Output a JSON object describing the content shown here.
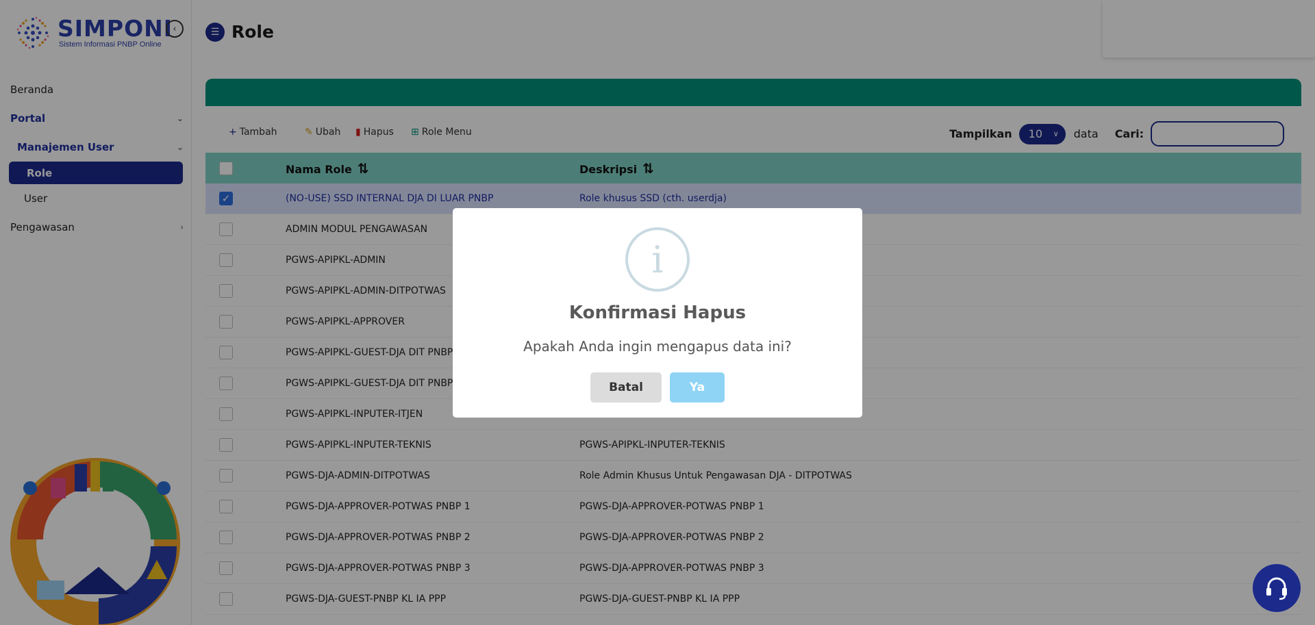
{
  "brand": {
    "title": "SIMPONI",
    "subtitle": "Sistem Informasi PNBP Online"
  },
  "sidebar": {
    "items": [
      {
        "label": "Beranda"
      },
      {
        "label": "Portal"
      },
      {
        "label": "Manajemen User"
      },
      {
        "label": "Role"
      },
      {
        "label": "User"
      },
      {
        "label": "Pengawasan"
      }
    ]
  },
  "page": {
    "title": "Role"
  },
  "toolbar": {
    "add_label": "Tambah",
    "edit_label": "Ubah",
    "delete_label": "Hapus",
    "role_menu_label": "Role Menu",
    "show_label": "Tampilkan",
    "page_length": "10",
    "data_label": "data",
    "search_label": "Cari:",
    "search_value": ""
  },
  "table": {
    "columns": [
      "Nama Role",
      "Deskripsi"
    ],
    "rows": [
      {
        "name": "(NO-USE) SSD INTERNAL DJA DI LUAR PNBP",
        "desc": "Role khusus SSD (cth. userdja)",
        "checked": true
      },
      {
        "name": "ADMIN MODUL PENGAWASAN",
        "desc": "",
        "checked": false
      },
      {
        "name": "PGWS-APIPKL-ADMIN",
        "desc": "",
        "checked": false
      },
      {
        "name": "PGWS-APIPKL-ADMIN-DITPOTWAS",
        "desc": "",
        "checked": false
      },
      {
        "name": "PGWS-APIPKL-APPROVER",
        "desc": "",
        "checked": false
      },
      {
        "name": "PGWS-APIPKL-GUEST-DJA DIT PNBP KL",
        "desc": "",
        "checked": false
      },
      {
        "name": "PGWS-APIPKL-GUEST-DJA DIT PNBP SDA",
        "desc": "",
        "checked": false
      },
      {
        "name": "PGWS-APIPKL-INPUTER-ITJEN",
        "desc": "",
        "checked": false
      },
      {
        "name": "PGWS-APIPKL-INPUTER-TEKNIS",
        "desc": "PGWS-APIPKL-INPUTER-TEKNIS",
        "checked": false
      },
      {
        "name": "PGWS-DJA-ADMIN-DITPOTWAS",
        "desc": "Role Admin Khusus Untuk Pengawasan DJA - DITPOTWAS",
        "checked": false
      },
      {
        "name": "PGWS-DJA-APPROVER-POTWAS PNBP 1",
        "desc": "PGWS-DJA-APPROVER-POTWAS PNBP 1",
        "checked": false
      },
      {
        "name": "PGWS-DJA-APPROVER-POTWAS PNBP 2",
        "desc": "PGWS-DJA-APPROVER-POTWAS PNBP 2",
        "checked": false
      },
      {
        "name": "PGWS-DJA-APPROVER-POTWAS PNBP 3",
        "desc": "PGWS-DJA-APPROVER-POTWAS PNBP 3",
        "checked": false
      },
      {
        "name": "PGWS-DJA-GUEST-PNBP KL IA PPP",
        "desc": "PGWS-DJA-GUEST-PNBP KL IA PPP",
        "checked": false
      }
    ]
  },
  "modal": {
    "title": "Konfirmasi Hapus",
    "message": "Apakah Anda ingin mengapus data ini?",
    "cancel_label": "Batal",
    "confirm_label": "Ya"
  },
  "colors": {
    "primary": "#1c2a8c",
    "teal": "#00917c",
    "teal_light": "#7fd3c7",
    "confirm": "#8fd4f5"
  }
}
